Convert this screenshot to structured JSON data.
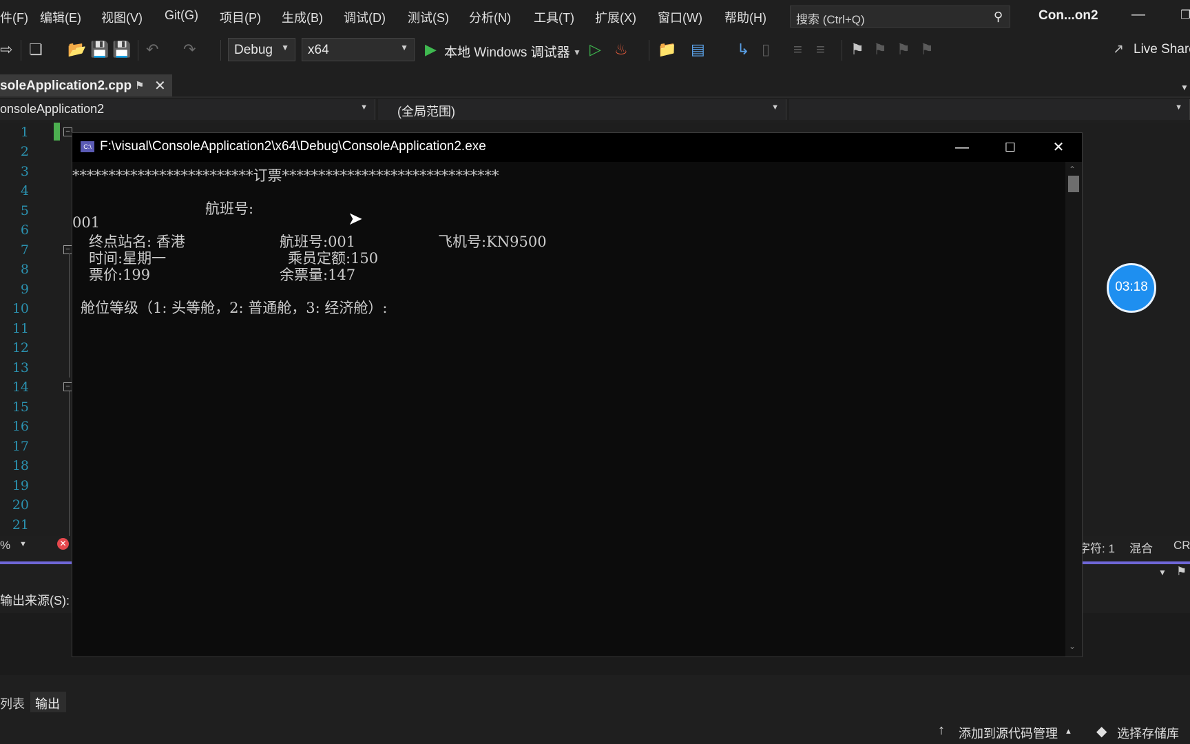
{
  "menu": {
    "items": [
      "件(F)",
      "编辑(E)",
      "视图(V)",
      "Git(G)",
      "项目(P)",
      "生成(B)",
      "调试(D)",
      "测试(S)",
      "分析(N)",
      "工具(T)",
      "扩展(X)",
      "窗口(W)",
      "帮助(H)"
    ],
    "search_placeholder": "搜索 (Ctrl+Q)",
    "window_title": "Con...on2"
  },
  "toolbar": {
    "config": "Debug",
    "platform": "x64",
    "debugger": "本地 Windows 调试器",
    "live_share": "Live Share"
  },
  "tab": {
    "file": "soleApplication2.cpp"
  },
  "nav": {
    "project": "onsoleApplication2",
    "scope": "(全局范围)"
  },
  "editor": {
    "line_numbers": [
      "1",
      "2",
      "3",
      "4",
      "5",
      "6",
      "7",
      "8",
      "9",
      "10",
      "11",
      "12",
      "13",
      "14",
      "15",
      "16",
      "17",
      "18",
      "19",
      "20",
      "21"
    ],
    "zoom": "%",
    "char_label": "字符: 1",
    "encoding": "混合",
    "eol": "CR"
  },
  "output": {
    "source_label": "输出来源(S):"
  },
  "bottom_tabs": {
    "list": "列表",
    "output": "输出"
  },
  "statusbar": {
    "add_to_source": "添加到源代码管理",
    "select_repo": "选择存储库"
  },
  "timer": "03:18",
  "console": {
    "title": "F:\\visual\\ConsoleApplication2\\x64\\Debug\\ConsoleApplication2.exe",
    "lines": {
      "header": "*************************订票******************************",
      "prompt": "航班号:",
      "input": "001",
      "dest": "终点站名: 香港",
      "flight": "航班号:001",
      "plane": "飞机号:KN9500",
      "time": "时间:星期一",
      "capacity": "乘员定额:150",
      "price": "票价:199",
      "remaining": "余票量:147",
      "cabin": "舱位等级（1: 头等舱，2: 普通舱，3: 经济舱）:"
    }
  }
}
